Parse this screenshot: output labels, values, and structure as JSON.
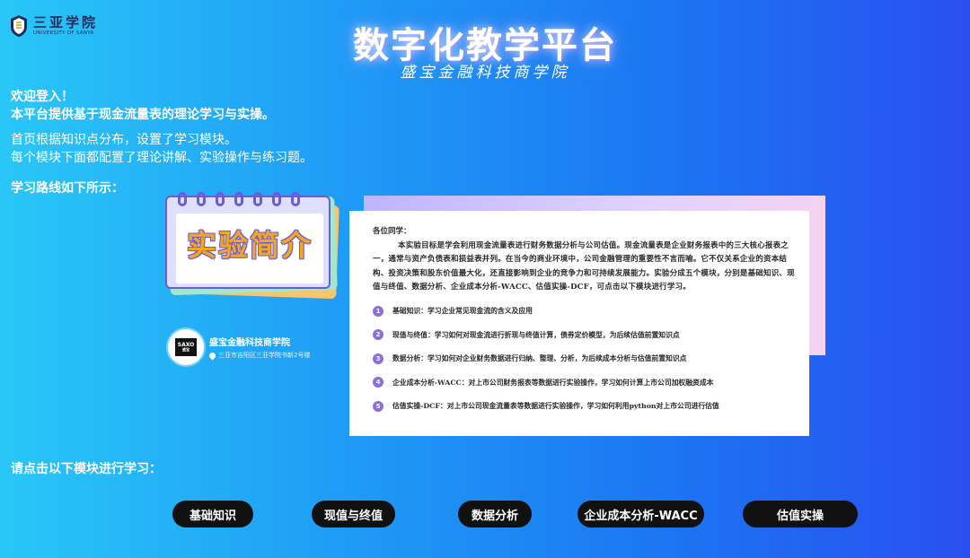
{
  "header": {
    "logo_cn": "三亚学院",
    "logo_en": "UNIVERSITY OF SANYA",
    "title": "数字化教学平台",
    "subtitle": "盛宝金融科技商学院"
  },
  "intro": {
    "welcome": "欢迎登入！",
    "platform_desc": "本平台提供基于现金流量表的理论学习与实操。",
    "line1": "首页根据知识点分布，设置了学习模块。",
    "line2": "每个模块下面都配置了理论讲解、实验操作与练习题。",
    "route_label": "学习路线如下所示："
  },
  "notebook": {
    "title": "实验简介"
  },
  "school": {
    "logo_text": "SAXO",
    "logo_subtext": "盛宝",
    "name": "盛宝金融科技商学院",
    "address": "三亚市吉阳区三亚学院书新2号楼"
  },
  "card": {
    "greeting": "各位同学：",
    "description": "本实验目标是学会利用现金流量表进行财务数据分析与公司估值。现金流量表是企业财务报表中的三大核心报表之一，通常与资产负债表和损益表并列。在当今的商业环境中，公司金融管理的重要性不言而喻。它不仅关系企业的资本结构、投资决策和股东价值最大化，还直接影响到企业的竞争力和可持续发展能力。实验分成五个模块，分别是基础知识、现值与终值、数据分析、企业成本分析-WACC、估值实操-DCF，可点击以下模块进行学习。",
    "modules": [
      {
        "num": "1",
        "text": "基础知识：学习企业常见现金流的含义及应用"
      },
      {
        "num": "2",
        "text": "现值与终值：学习如何对现金流进行折现与终值计算，债券定价模型，为后续估值前置知识点"
      },
      {
        "num": "3",
        "text": "数据分析：学习如何对企业财务数据进行归纳、整理、分析，为后续成本分析与估值前置知识点"
      },
      {
        "num": "4",
        "text": "企业成本分析-WACC：对上市公司财务报表等数据进行实验操作，学习如何计算上市公司加权融资成本"
      },
      {
        "num": "5",
        "text": "估值实操-DCF：对上市公司现金流量表等数据进行实验操作，学习如何利用python对上市公司进行估值"
      }
    ]
  },
  "footer": {
    "click_label": "请点击以下模块进行学习：",
    "buttons": [
      "基础知识",
      "现值与终值",
      "数据分析",
      "企业成本分析-WACC",
      "估值实操"
    ]
  },
  "colors": {
    "bg_left": "#29c7f7",
    "bg_right": "#2a4ff0",
    "accent_purple": "#8b6fe0",
    "button_bg": "#111111",
    "notebook_title": "#f4a623"
  },
  "icons": {
    "logo": "university-seal-icon",
    "pin": "location-pin-icon"
  }
}
